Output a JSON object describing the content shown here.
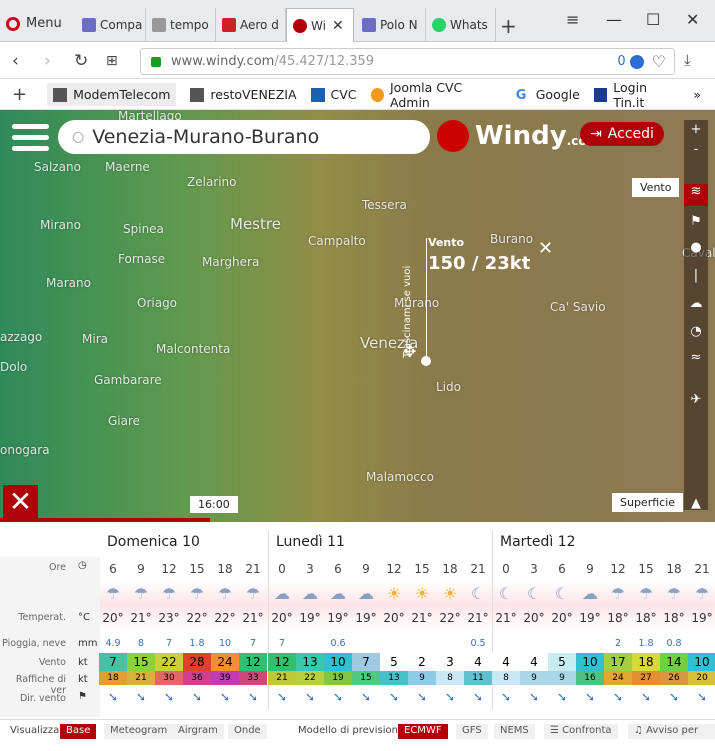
{
  "browser": {
    "menu_label": "Menu",
    "tabs": [
      {
        "label": "Compa",
        "color": "#5a5ab0"
      },
      {
        "label": "tempo",
        "color": "#888888"
      },
      {
        "label": "Aero d",
        "color": "#cc2222"
      },
      {
        "label": "Wi",
        "color": "#b0000a"
      },
      {
        "label": "Polo N",
        "color": "#5a5ab0"
      },
      {
        "label": "Whats",
        "color": "#25d366"
      }
    ],
    "new_tab": "+",
    "url_domain": "www.windy.com",
    "url_path": "/45.427/12.359",
    "url_badge": "0",
    "bookmarks": [
      {
        "label": "ModemTelecom",
        "icon": "page-icon"
      },
      {
        "label": "restoVENEZIA",
        "icon": "page-icon"
      },
      {
        "label": "CVC",
        "icon": "cvc-icon"
      },
      {
        "label": "Joomla CVC Admin",
        "icon": "joomla-icon"
      },
      {
        "label": "Google",
        "icon": "google-icon"
      },
      {
        "label": "Login Tin.it",
        "icon": "tin-icon"
      }
    ],
    "bookmarks_more": "»"
  },
  "map": {
    "search_value": "Venezia-Murano-Burano",
    "logo": "Windy",
    "logo_suffix": ".com",
    "login_label": "Accedi",
    "layer_tooltip": "Vento",
    "surface_label": "Superficie",
    "popup_title": "Vento",
    "popup_value": "150 / 23kt",
    "drag_hint": "Trascinami se vuoi",
    "time_label": "16:00",
    "places": [
      {
        "name": "Martellago",
        "size": "small"
      },
      {
        "name": "Salzano",
        "size": "small"
      },
      {
        "name": "Maerne",
        "size": "small"
      },
      {
        "name": "Zelarino",
        "size": "small"
      },
      {
        "name": "Mirano",
        "size": "normal"
      },
      {
        "name": "Spinea",
        "size": "normal"
      },
      {
        "name": "Mestre",
        "size": "big"
      },
      {
        "name": "Tessera",
        "size": "small"
      },
      {
        "name": "Campalto",
        "size": "small"
      },
      {
        "name": "Burano",
        "size": "small"
      },
      {
        "name": "Fornase",
        "size": "small"
      },
      {
        "name": "Marghera",
        "size": "normal"
      },
      {
        "name": "Marano",
        "size": "small"
      },
      {
        "name": "Oriago",
        "size": "normal"
      },
      {
        "name": "Murano",
        "size": "small"
      },
      {
        "name": "Ca' Savio",
        "size": "small"
      },
      {
        "name": "Mira",
        "size": "normal"
      },
      {
        "name": "Malcontenta",
        "size": "small"
      },
      {
        "name": "Venezia",
        "size": "big"
      },
      {
        "name": "Dolo",
        "size": "normal"
      },
      {
        "name": "Gambarare",
        "size": "small"
      },
      {
        "name": "Lido",
        "size": "normal"
      },
      {
        "name": "Giare",
        "size": "small"
      },
      {
        "name": "onogara",
        "size": "normal"
      },
      {
        "name": "Malamocco",
        "size": "small"
      },
      {
        "name": "azzago",
        "size": "small"
      },
      {
        "name": "Cavallino",
        "size": "small"
      }
    ]
  },
  "forecast": {
    "days": [
      "Domenica 10",
      "Lunedì 11",
      "Martedì 12"
    ],
    "row_labels": {
      "ore": "Ore",
      "temp": "Temperat.",
      "temp_unit": "°C",
      "rain": "Pioggia, neve",
      "rain_unit": "mm",
      "wind": "Vento",
      "wind_unit": "kt",
      "gust": "Raffiche di ver",
      "gust_unit": "kt",
      "dir": "Dir. vento"
    },
    "hours": [
      "6",
      "9",
      "12",
      "15",
      "18",
      "21",
      "0",
      "3",
      "6",
      "9",
      "12",
      "15",
      "18",
      "21",
      "0",
      "3",
      "6",
      "9",
      "12",
      "15",
      "18",
      "21"
    ],
    "temps": [
      "20°",
      "21°",
      "23°",
      "22°",
      "22°",
      "21°",
      "20°",
      "19°",
      "19°",
      "19°",
      "20°",
      "21°",
      "22°",
      "21°",
      "21°",
      "20°",
      "20°",
      "19°",
      "18°",
      "18°",
      "18°",
      "19°"
    ],
    "rain": [
      "4.9",
      "8",
      "7",
      "1.8",
      "10",
      "7",
      "7",
      "",
      "0.6",
      "",
      "",
      "",
      "",
      "0.5",
      "",
      "",
      "",
      "",
      "2",
      "1.8",
      "0.8",
      ""
    ],
    "wind": [
      "7",
      "15",
      "22",
      "28",
      "24",
      "12",
      "12",
      "13",
      "10",
      "7",
      "5",
      "2",
      "3",
      "4",
      "4",
      "4",
      "5",
      "10",
      "17",
      "18",
      "14",
      "10"
    ],
    "gust": [
      "18",
      "21",
      "30",
      "36",
      "39",
      "33",
      "21",
      "22",
      "19",
      "15",
      "13",
      "9",
      "8",
      "11",
      "8",
      "9",
      "9",
      "16",
      "24",
      "27",
      "26",
      "20"
    ],
    "wind_colors": [
      "#48c0a8",
      "#8ad43a",
      "#c8d03a",
      "#e0402e",
      "#f09030",
      "#30c070",
      "#30c070",
      "#38c8b0",
      "#30c0d0",
      "#a0c8e0",
      "#ffffff",
      "#ffffff",
      "#ffffff",
      "#ffffff",
      "#ffffff",
      "#ffffff",
      "#c8ecf4",
      "#30c0d0",
      "#a0d040",
      "#d8d838",
      "#70d040",
      "#30c0d0"
    ],
    "gust_colors": [
      "#e0a030",
      "#d8b040",
      "#e06868",
      "#d04090",
      "#c03cb0",
      "#d04878",
      "#c0c838",
      "#b8d040",
      "#80c840",
      "#50c880",
      "#48c0c8",
      "#8ccce8",
      "#c8e8f4",
      "#60c0d0",
      "#c8e8f4",
      "#a8d8e8",
      "#a8d8e8",
      "#50c080",
      "#e0a830",
      "#e09030",
      "#d89840",
      "#d8c038"
    ],
    "bottom": {
      "visualizza": "Visualizza",
      "modes": [
        "Base",
        "Meteogram",
        "Airgram",
        "Onde"
      ],
      "model_label": "Modello di previsione",
      "models": [
        "ECMWF",
        "GFS",
        "NEMS"
      ],
      "compare": "Confronta",
      "alert": "Avviso per"
    }
  }
}
